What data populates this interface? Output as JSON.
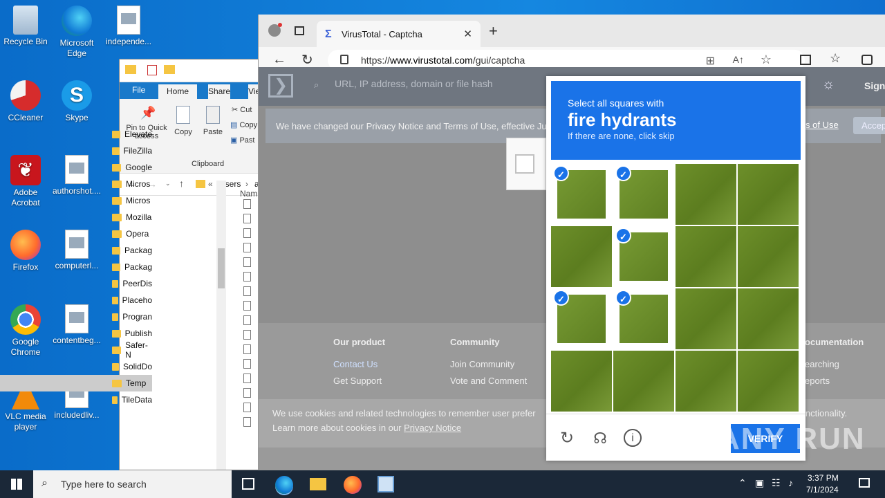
{
  "desktop": {
    "icons": [
      {
        "label": "Recycle Bin"
      },
      {
        "label": "Microsoft Edge"
      },
      {
        "label": "independe..."
      },
      {
        "label": "CCleaner"
      },
      {
        "label": "Skype"
      },
      {
        "label": "Adobe Acrobat"
      },
      {
        "label": "authorshot...."
      },
      {
        "label": "Firefox"
      },
      {
        "label": "computerl..."
      },
      {
        "label": "Google Chrome"
      },
      {
        "label": "contentbeg..."
      },
      {
        "label": "VLC media player"
      },
      {
        "label": "includedliv..."
      }
    ]
  },
  "explorer": {
    "tabs": [
      "File",
      "Home",
      "Share",
      "Vie"
    ],
    "ribbon": {
      "pin_label": "Pin to Quick access",
      "copy_label": "Copy",
      "paste_label": "Paste",
      "cut_label": "Cut",
      "copy_path_label": "Copy",
      "paste_shortcut_label": "Past",
      "group_label": "Clipboard"
    },
    "breadcrumb": [
      "«",
      "Users",
      "a"
    ],
    "column_header": "Nam",
    "folders": [
      "Elevate",
      "FileZilla",
      "Google",
      "Micros",
      "Micros",
      "Mozilla",
      "Opera",
      "Packag",
      "Packag",
      "PeerDis",
      "Placeho",
      "Progran",
      "Publish",
      "Safer-N",
      "SolidDo",
      "Temp",
      "TileData"
    ]
  },
  "browser": {
    "tab_title": "VirusTotal - Captcha",
    "url_prefix": "https://",
    "url_domain": "www.virustotal.com",
    "url_path": "/gui/captcha",
    "page": {
      "search_placeholder": "URL, IP address, domain or file hash",
      "sign_in": "Sign in",
      "notice": "We have changed our Privacy Notice and Terms of Use, effective Ju",
      "notice_link": "s of Use",
      "accept": "Accep",
      "footer": {
        "col1_title": "Our product",
        "col1_items": [
          "Contact Us",
          "Get Support"
        ],
        "col2_title": "Community",
        "col2_items": [
          "Join Community",
          "Vote and Comment"
        ],
        "col3_title": "ocumentation",
        "col3_items": [
          "earching",
          "eports"
        ]
      },
      "cookie_line1": "We use cookies and related technologies to remember user prefer",
      "cookie_line1_tail": "functionality.",
      "cookie_line2": "Learn more about cookies in our",
      "cookie_link": "Privacy Notice"
    },
    "captcha": {
      "instruction": "Select all squares with",
      "target": "fire hydrants",
      "hint": "If there are none, click skip",
      "selected_cells": [
        0,
        1,
        5,
        8,
        9
      ],
      "verify_label": "VERIFY"
    }
  },
  "watermark": "ANY RUN",
  "taskbar": {
    "search_placeholder": "Type here to search",
    "time": "3:37 PM",
    "date": "7/1/2024"
  }
}
